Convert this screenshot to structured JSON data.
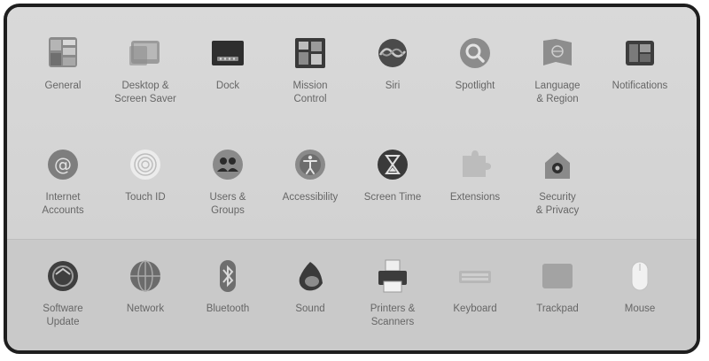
{
  "window": {
    "sections": [
      {
        "items": [
          {
            "id": "general",
            "label": "General",
            "icon": "general-icon"
          },
          {
            "id": "desktop",
            "label": "Desktop &\nScreen Saver",
            "icon": "desktop-screensaver-icon"
          },
          {
            "id": "dock",
            "label": "Dock",
            "icon": "dock-icon"
          },
          {
            "id": "mission",
            "label": "Mission\nControl",
            "icon": "mission-control-icon"
          },
          {
            "id": "siri",
            "label": "Siri",
            "icon": "siri-icon"
          },
          {
            "id": "spotlight",
            "label": "Spotlight",
            "icon": "spotlight-icon"
          },
          {
            "id": "language",
            "label": "Language\n& Region",
            "icon": "language-region-icon"
          },
          {
            "id": "notifications",
            "label": "Notifications",
            "icon": "notifications-icon"
          }
        ]
      },
      {
        "items": [
          {
            "id": "internet",
            "label": "Internet\nAccounts",
            "icon": "internet-accounts-icon"
          },
          {
            "id": "touchid",
            "label": "Touch ID",
            "icon": "touch-id-icon"
          },
          {
            "id": "users",
            "label": "Users &\nGroups",
            "icon": "users-groups-icon"
          },
          {
            "id": "accessibility",
            "label": "Accessibility",
            "icon": "accessibility-icon"
          },
          {
            "id": "screentime",
            "label": "Screen Time",
            "icon": "screen-time-icon"
          },
          {
            "id": "extensions",
            "label": "Extensions",
            "icon": "extensions-icon"
          },
          {
            "id": "security",
            "label": "Security\n& Privacy",
            "icon": "security-privacy-icon"
          }
        ]
      },
      {
        "items": [
          {
            "id": "software",
            "label": "Software\nUpdate",
            "icon": "software-update-icon"
          },
          {
            "id": "network",
            "label": "Network",
            "icon": "network-icon"
          },
          {
            "id": "bluetooth",
            "label": "Bluetooth",
            "icon": "bluetooth-icon"
          },
          {
            "id": "sound",
            "label": "Sound",
            "icon": "sound-icon"
          },
          {
            "id": "printers",
            "label": "Printers &\nScanners",
            "icon": "printers-scanners-icon"
          },
          {
            "id": "keyboard",
            "label": "Keyboard",
            "icon": "keyboard-icon"
          },
          {
            "id": "trackpad",
            "label": "Trackpad",
            "icon": "trackpad-icon"
          },
          {
            "id": "mouse",
            "label": "Mouse",
            "icon": "mouse-icon"
          }
        ]
      }
    ]
  },
  "colors": {
    "frame": "#1e1e1e",
    "panel_top": "#d6d6d6",
    "panel_bottom": "#c9c9c9",
    "label": "#666666"
  }
}
